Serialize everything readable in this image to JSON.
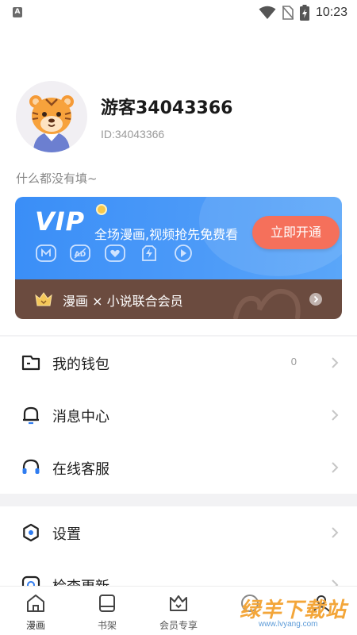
{
  "status_bar": {
    "time": "10:23",
    "app_indicator": "A"
  },
  "profile": {
    "username": "游客34043366",
    "id_text": "ID:34043366",
    "bio": "什么都没有填~"
  },
  "vip_card": {
    "logo": "VIP",
    "description": "全场漫画,视频抢先免费看",
    "cta_label": "立即开通",
    "perk_icons": [
      "m-badge-icon",
      "ad-free-icon",
      "heart-icon",
      "lightning-icon",
      "play-icon"
    ],
    "accent_color": "#3a8ef7",
    "cta_color": "#f5705b"
  },
  "union_banner": {
    "label": "漫画 × 小说联合会员",
    "bg_color": "#6b4b3f"
  },
  "menu": {
    "group1": [
      {
        "label": "我的钱包",
        "value": "0",
        "icon": "wallet-icon"
      },
      {
        "label": "消息中心",
        "value": "",
        "icon": "bell-icon"
      },
      {
        "label": "在线客服",
        "value": "",
        "icon": "headset-icon"
      }
    ],
    "group2": [
      {
        "label": "设置",
        "value": "",
        "icon": "settings-icon"
      },
      {
        "label": "检查更新",
        "value": "",
        "icon": "update-icon"
      }
    ]
  },
  "tab_bar": {
    "tabs": [
      {
        "label": "漫画",
        "icon": "home-icon"
      },
      {
        "label": "书架",
        "icon": "bookshelf-icon"
      },
      {
        "label": "会员专享",
        "icon": "crown-icon"
      },
      {
        "label": "",
        "icon": "dashboard-icon"
      },
      {
        "label": "",
        "icon": "profile-icon"
      }
    ]
  },
  "watermark": {
    "text": "绿羊下载站",
    "sub": "www.lvyang.com"
  }
}
